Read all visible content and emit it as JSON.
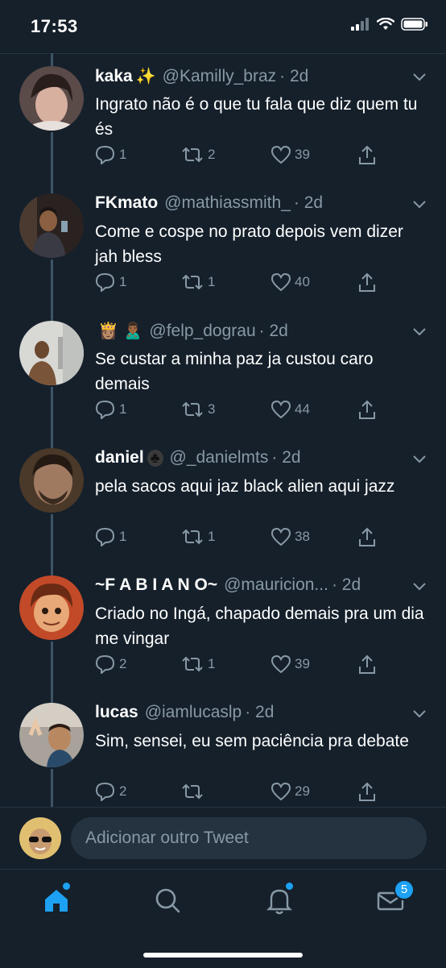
{
  "status_bar": {
    "time": "17:53"
  },
  "tweets": [
    {
      "name": "kaka",
      "emoji": "✨",
      "handle": "@Kamilly_braz",
      "time": "· 2d",
      "text": "Ingrato não é o que tu fala que diz quem tu és",
      "replies": "1",
      "retweets": "2",
      "likes": "39"
    },
    {
      "name": "FKmato",
      "emoji": "",
      "handle": "@mathiassmith_",
      "time": "· 2d",
      "text": "Come e cospe no prato depois vem dizer jah bless",
      "replies": "1",
      "retweets": "1",
      "likes": "40"
    },
    {
      "name": "",
      "emoji": "👸🏽 🙎🏾‍♂️",
      "handle": "@felp_dograu",
      "time": "· 2d",
      "text": "Se custar a minha paz ja custou caro demais",
      "replies": "1",
      "retweets": "3",
      "likes": "44"
    },
    {
      "name": "daniel",
      "emoji": "♣",
      "handle": "@_danielmts",
      "time": "· 2d",
      "text": "pela sacos aqui jaz black alien aqui jazz",
      "replies": "1",
      "retweets": "1",
      "likes": "38"
    },
    {
      "name": "~F A B I A N O~",
      "emoji": "",
      "handle": "@mauricion...",
      "time": "· 2d",
      "text": "Criado no Ingá, chapado demais pra um dia me vingar",
      "replies": "2",
      "retweets": "1",
      "likes": "39"
    },
    {
      "name": "lucas",
      "emoji": "",
      "handle": "@iamlucaslp",
      "time": "· 2d",
      "text": "Sim, sensei, eu sem paciência pra debate",
      "replies": "2",
      "retweets": "",
      "likes": "29"
    }
  ],
  "compose": {
    "placeholder": "Adicionar outro Tweet"
  },
  "tabbar": {
    "messages_badge": "5"
  },
  "colors": {
    "background": "#15202b",
    "accent": "#1da1f2",
    "muted": "#8899a6"
  }
}
